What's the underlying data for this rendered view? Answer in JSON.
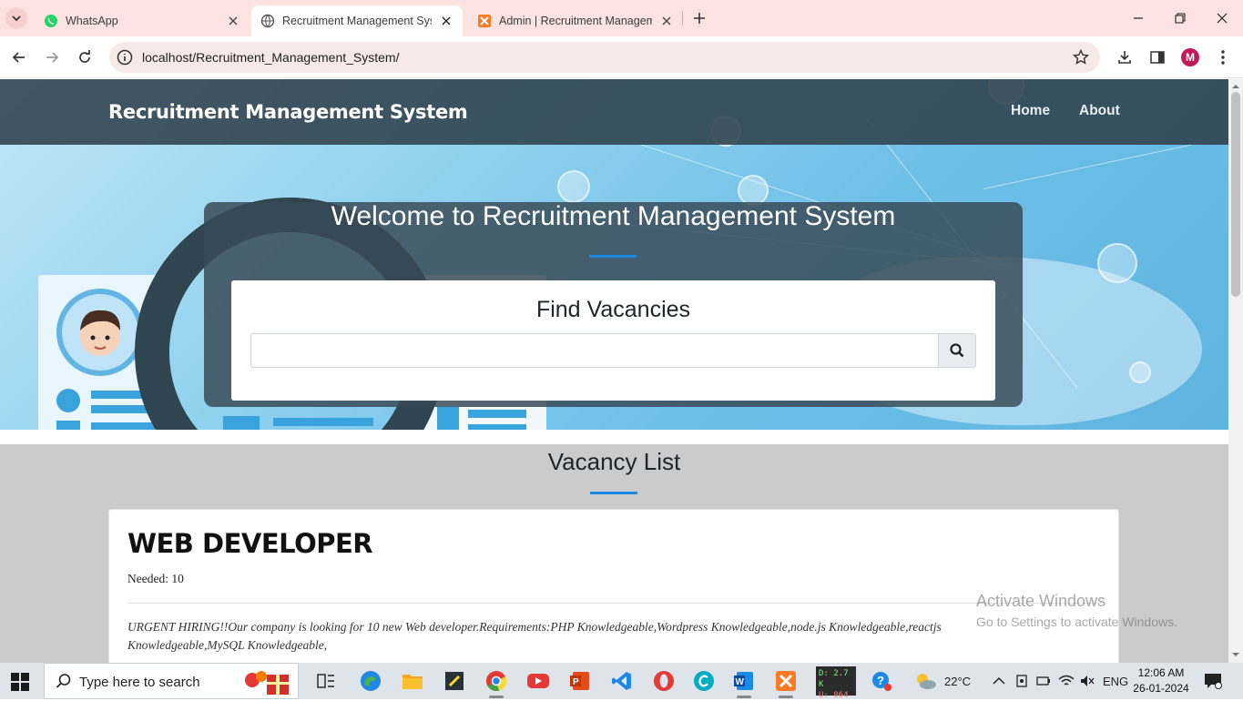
{
  "browser": {
    "tabs": [
      {
        "title": "WhatsApp",
        "icon": "whatsapp-icon"
      },
      {
        "title": "Recruitment Management Syste",
        "icon": "globe-icon"
      },
      {
        "title": "Admin | Recruitment Managem",
        "icon": "xampp-icon"
      }
    ],
    "address_url": "localhost/Recruitment_Management_System/",
    "profile_initial": "M"
  },
  "site": {
    "brand": "Recruitment Management System",
    "nav": {
      "home": "Home",
      "about": "About"
    },
    "hero_heading": "Welcome to Recruitment Management System",
    "search_title": "Find Vacancies",
    "search_value": "",
    "vacancy_heading": "Vacancy List",
    "accent_color": "#1e88e5"
  },
  "vacancies": [
    {
      "title": "WEB DEVELOPER",
      "needed": "Needed: 10",
      "description": "URGENT HIRING!!Our company is looking for 10 new Web developer.Requirements:PHP Knowledgeable,Wordpress Knowledgeable,node.js Knowledgeable,reactjs Knowledgeable,MySQL Knowledgeable,"
    }
  ],
  "watermark": {
    "line1": "Activate Windows",
    "line2": "Go to Settings to activate Windows."
  },
  "taskbar": {
    "search_placeholder": "Type here to search",
    "net_down": "D: 2.7 K",
    "net_up": "U: 864",
    "temperature": "22°C",
    "language": "ENG",
    "time": "12:06 AM",
    "date": "26-01-2024"
  }
}
